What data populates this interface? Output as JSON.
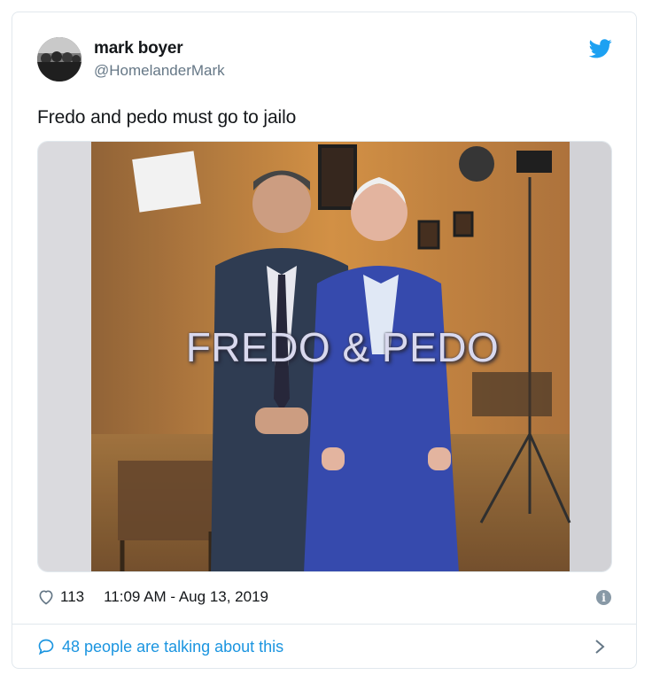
{
  "author": {
    "name": "mark boyer",
    "handle": "@HomelanderMark"
  },
  "tweet": {
    "text": "Fredo and pedo must go to jailo",
    "image_caption": "FREDO & PEDO"
  },
  "meta": {
    "likes": "113",
    "timestamp": "11:09 AM - Aug 13, 2019"
  },
  "footer": {
    "conversation_label": "48 people are talking about this"
  },
  "colors": {
    "twitter_blue": "#1da1f2",
    "link_blue": "#1b95e0",
    "muted": "#657786"
  },
  "icons": [
    "twitter-bird-icon",
    "heart-icon",
    "info-icon",
    "comment-bubble-icon",
    "chevron-right-icon"
  ]
}
